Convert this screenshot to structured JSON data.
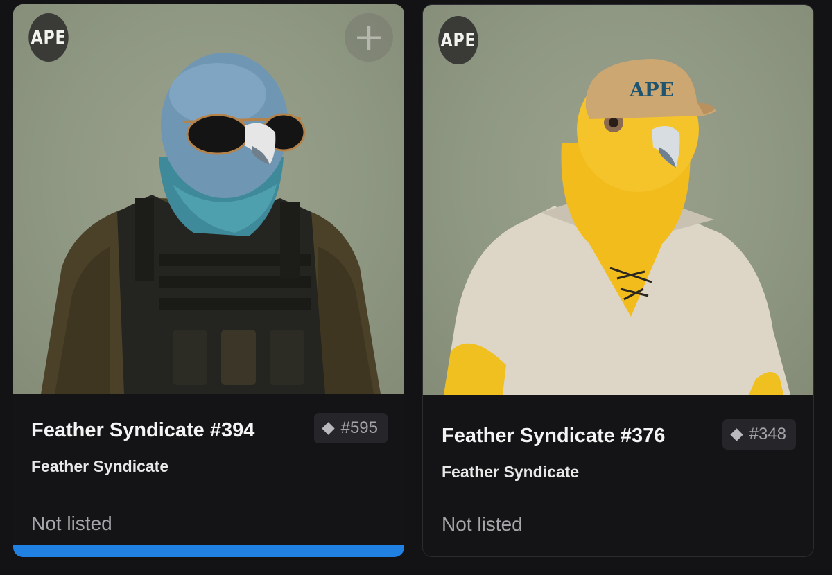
{
  "cards": [
    {
      "badge": "APE",
      "title": "Feather Syndicate #394",
      "collection": "Feather Syndicate",
      "rank": "#595",
      "status": "Not listed",
      "selected": true,
      "icons": [
        "ape-badge-icon",
        "add-icon",
        "diamond-icon"
      ]
    },
    {
      "badge": "APE",
      "cap_text": "APE",
      "title": "Feather Syndicate #376",
      "collection": "Feather Syndicate",
      "rank": "#348",
      "status": "Not listed",
      "selected": false,
      "icons": [
        "ape-badge-icon",
        "diamond-icon"
      ]
    }
  ],
  "colors": {
    "page_background": "#131315",
    "card_background": "#141416",
    "image_background": "#8f9883",
    "selected_accent": "#2081e2"
  }
}
